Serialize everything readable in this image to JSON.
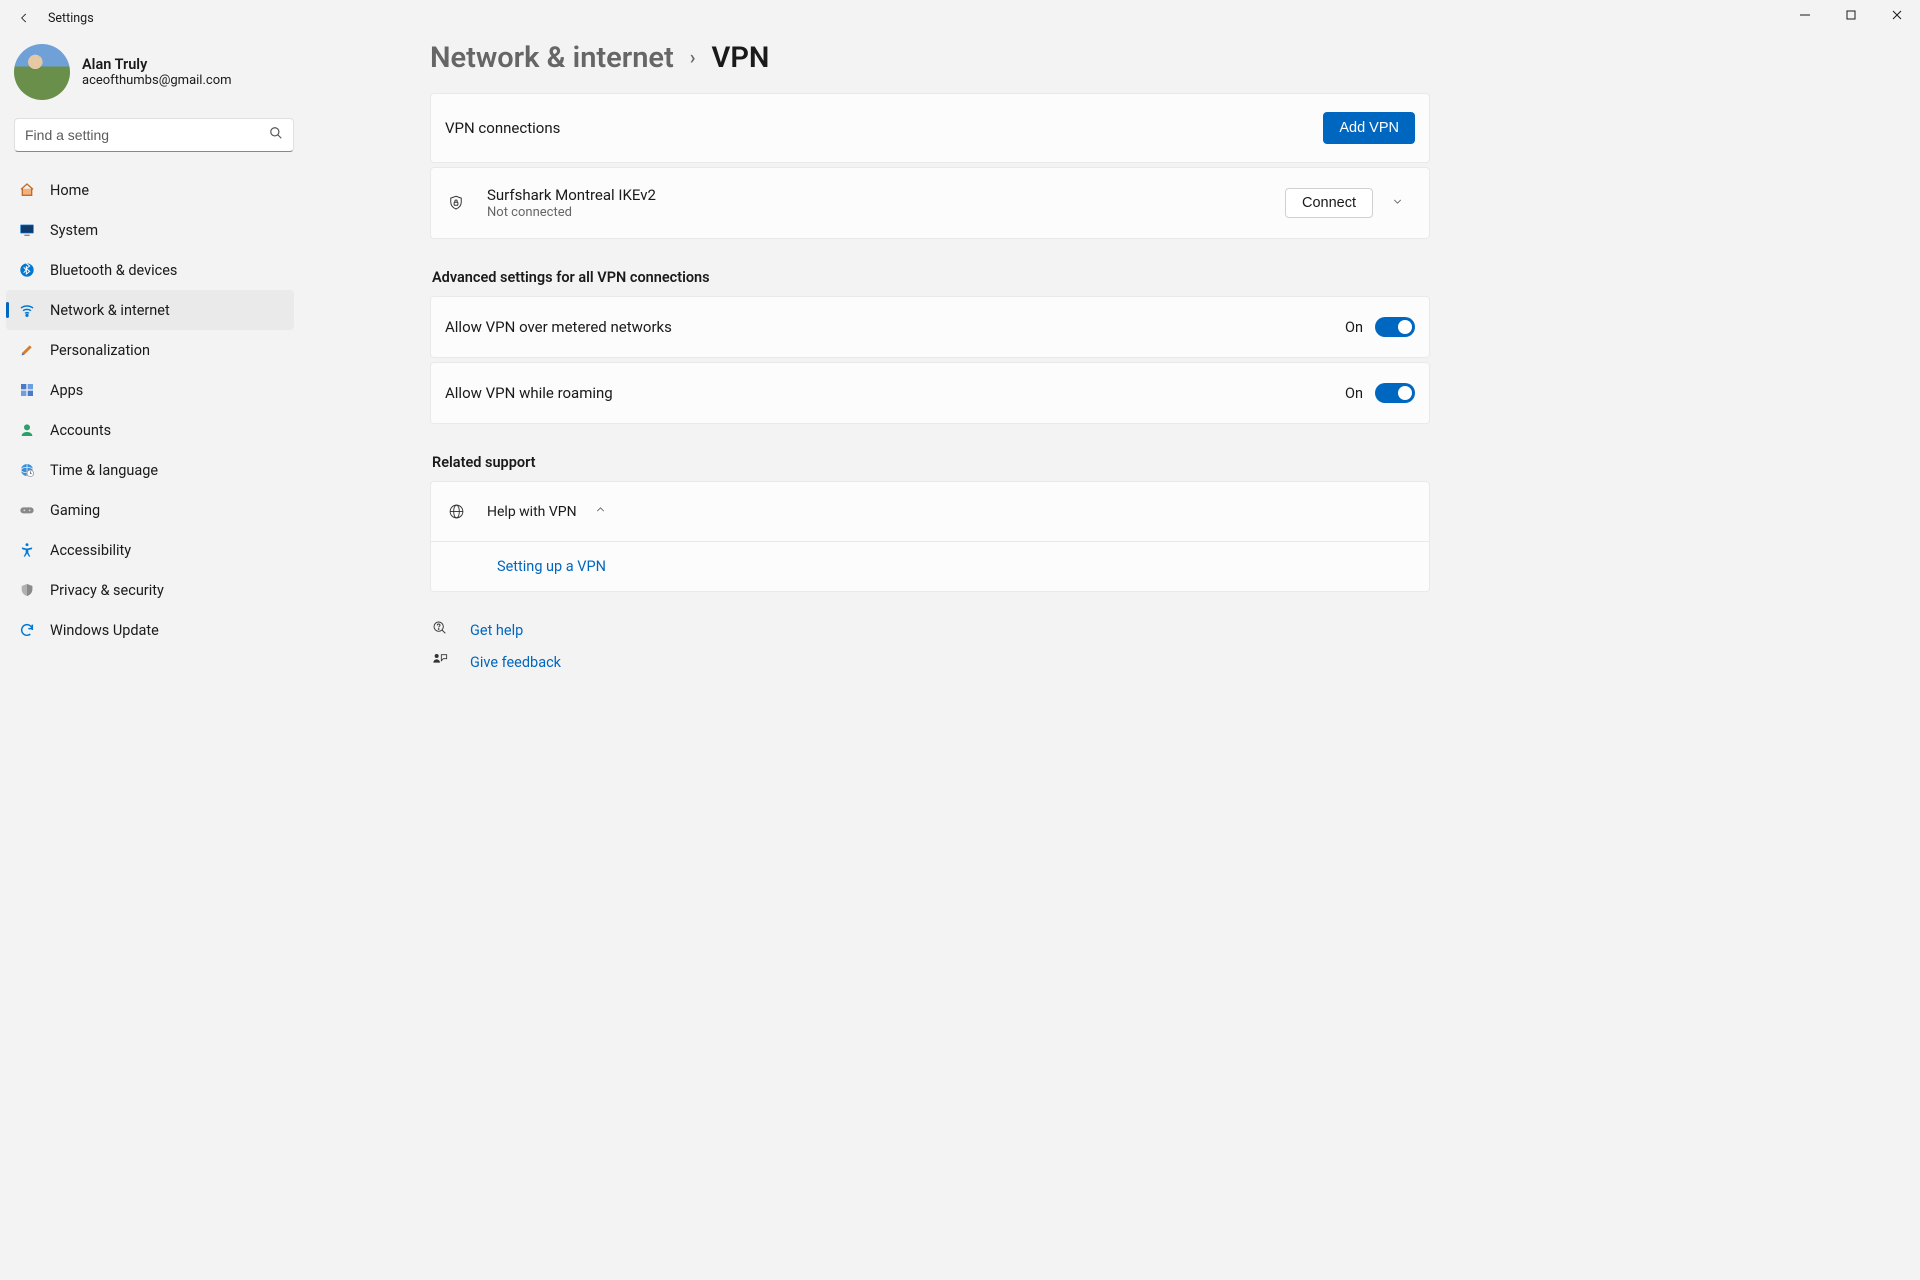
{
  "window": {
    "title": "Settings"
  },
  "profile": {
    "name": "Alan Truly",
    "email": "aceofthumbs@gmail.com"
  },
  "search": {
    "placeholder": "Find a setting"
  },
  "nav": {
    "items": [
      {
        "label": "Home"
      },
      {
        "label": "System"
      },
      {
        "label": "Bluetooth & devices"
      },
      {
        "label": "Network & internet"
      },
      {
        "label": "Personalization"
      },
      {
        "label": "Apps"
      },
      {
        "label": "Accounts"
      },
      {
        "label": "Time & language"
      },
      {
        "label": "Gaming"
      },
      {
        "label": "Accessibility"
      },
      {
        "label": "Privacy & security"
      },
      {
        "label": "Windows Update"
      }
    ],
    "active_index": 3
  },
  "breadcrumb": {
    "parent": "Network & internet",
    "current": "VPN"
  },
  "vpn": {
    "connections_label": "VPN connections",
    "add_label": "Add VPN",
    "items": [
      {
        "name": "Surfshark Montreal IKEv2",
        "status": "Not connected",
        "action": "Connect"
      }
    ]
  },
  "advanced": {
    "title": "Advanced settings for all VPN connections",
    "rows": [
      {
        "label": "Allow VPN over metered networks",
        "state": "On",
        "on": true
      },
      {
        "label": "Allow VPN while roaming",
        "state": "On",
        "on": true
      }
    ]
  },
  "related": {
    "title": "Related support",
    "help_label": "Help with VPN",
    "sub_link": "Setting up a VPN"
  },
  "support": {
    "get_help": "Get help",
    "give_feedback": "Give feedback"
  }
}
